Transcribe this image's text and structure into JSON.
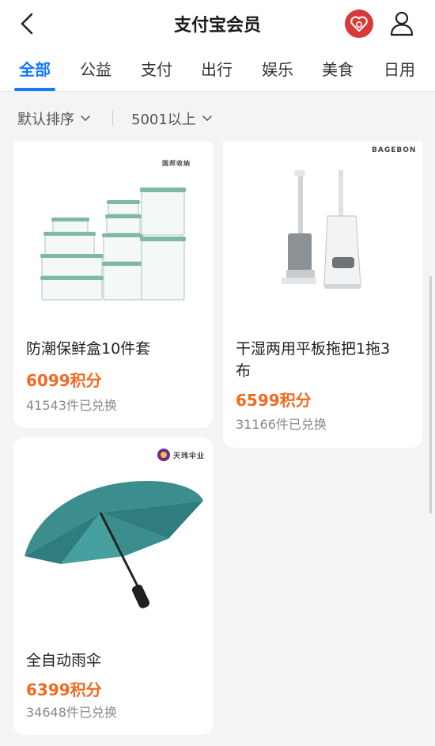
{
  "header": {
    "title": "支付宝会员",
    "back_icon": "chevron-left-icon",
    "heart_icon": "heart-icon",
    "user_icon": "user-icon",
    "heart_color": "#d83a3a"
  },
  "tabs": [
    {
      "label": "全部",
      "active": true
    },
    {
      "label": "公益"
    },
    {
      "label": "支付"
    },
    {
      "label": "出行"
    },
    {
      "label": "娱乐"
    },
    {
      "label": "美食"
    },
    {
      "label": "日用"
    }
  ],
  "filters": {
    "sort_label": "默认排序",
    "points_label": "5001以上"
  },
  "products": [
    {
      "name": "防潮保鲜盒10件套",
      "price": "6099积分",
      "sold": "41543件已兑换",
      "brand": "国邦收纳"
    },
    {
      "name": "干湿两用平板拖把1拖3布",
      "name_line1": "干湿两用平板拖把1拖3",
      "name_line2": "布",
      "price": "6599积分",
      "sold": "31166件已兑换",
      "brand": "BAGEBON"
    },
    {
      "name": "全自动雨伞",
      "price": "6399积分",
      "sold": "34648件已兑换",
      "brand": "天玮伞业"
    }
  ],
  "colors": {
    "accent": "#1677ff",
    "price": "#f06a1f",
    "background": "#f3f4f6"
  }
}
